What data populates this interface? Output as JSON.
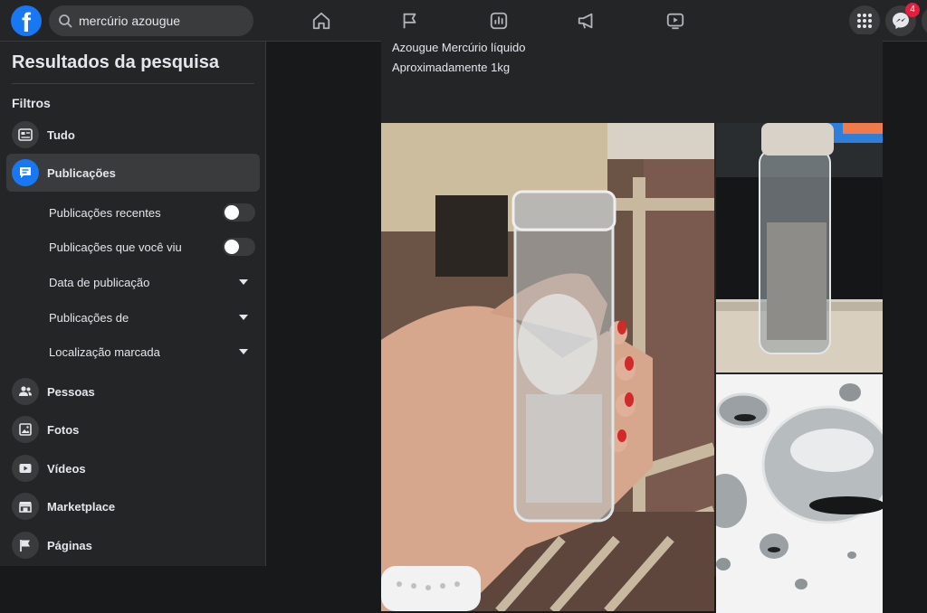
{
  "header": {
    "logo_letter": "f",
    "search": {
      "value": "mercúrio azougue",
      "placeholder": "Pesquisar no Facebook"
    },
    "nav_icons": [
      "home-icon",
      "flag-icon",
      "stats-icon",
      "megaphone-icon",
      "video-icon"
    ],
    "messenger_badge": "4"
  },
  "sidebar": {
    "title": "Resultados da pesquisa",
    "filters_label": "Filtros",
    "items": [
      {
        "label": "Tudo",
        "icon": "all-results-icon"
      },
      {
        "label": "Publicações",
        "icon": "posts-icon",
        "active": true
      }
    ],
    "post_filters": [
      {
        "label": "Publicações recentes",
        "control": "toggle",
        "on": false
      },
      {
        "label": "Publicações que você viu",
        "control": "toggle",
        "on": false
      },
      {
        "label": "Data de publicação",
        "control": "dropdown"
      },
      {
        "label": "Publicações de",
        "control": "dropdown"
      },
      {
        "label": "Localização marcada",
        "control": "dropdown"
      }
    ],
    "more_items": [
      {
        "label": "Pessoas",
        "icon": "people-icon"
      },
      {
        "label": "Fotos",
        "icon": "photos-icon"
      },
      {
        "label": "Vídeos",
        "icon": "videos-icon"
      },
      {
        "label": "Marketplace",
        "icon": "marketplace-icon"
      },
      {
        "label": "Páginas",
        "icon": "pages-icon"
      }
    ]
  },
  "post": {
    "line1": "Azougue Mercúrio líquido",
    "line2": "Aproximadamente 1kg"
  },
  "colors": {
    "brand": "#1877f2",
    "badge": "#e41e3f",
    "surface": "#242526",
    "background": "#18191a",
    "text": "#e4e6eb"
  }
}
